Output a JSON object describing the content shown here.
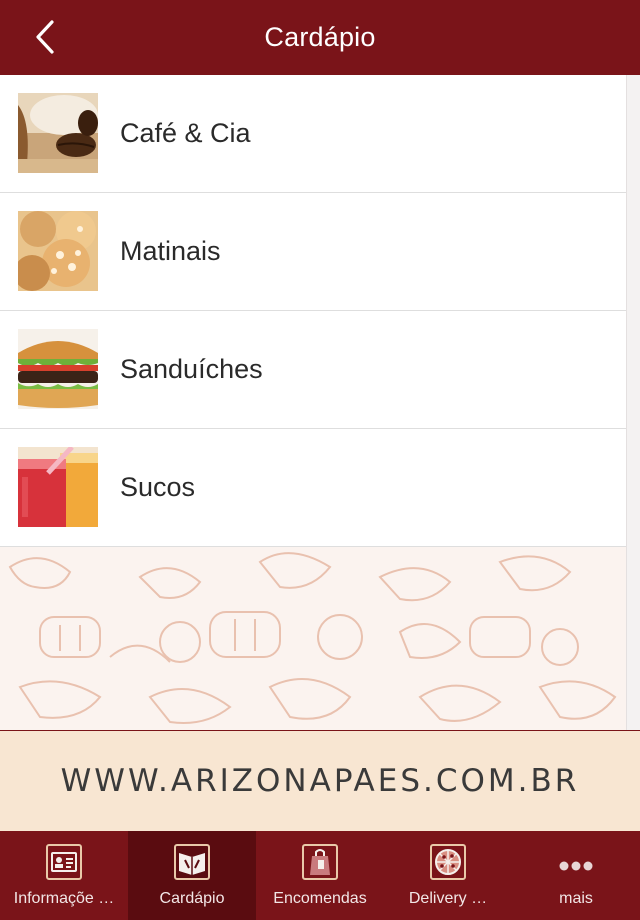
{
  "header": {
    "title": "Cardápio"
  },
  "menu_items": [
    {
      "label": "Café & Cia"
    },
    {
      "label": "Matinais"
    },
    {
      "label": "Sanduíches"
    },
    {
      "label": "Sucos"
    }
  ],
  "banner": {
    "text": "WWW.ARIZONAPAES.COM.BR"
  },
  "tabbar": {
    "tabs": [
      {
        "label": "Informaçõe …",
        "icon": "contact-card-icon"
      },
      {
        "label": "Cardápio",
        "icon": "menu-book-icon",
        "active": true
      },
      {
        "label": "Encomendas",
        "icon": "shopping-bag-icon"
      },
      {
        "label": "Delivery …",
        "icon": "pizza-icon"
      },
      {
        "label": "mais",
        "icon": "more-dots-icon"
      }
    ]
  },
  "colors": {
    "header_bg": "#7a1419",
    "tab_active_bg": "#5a0c10",
    "banner_bg": "#f8e6d2"
  }
}
